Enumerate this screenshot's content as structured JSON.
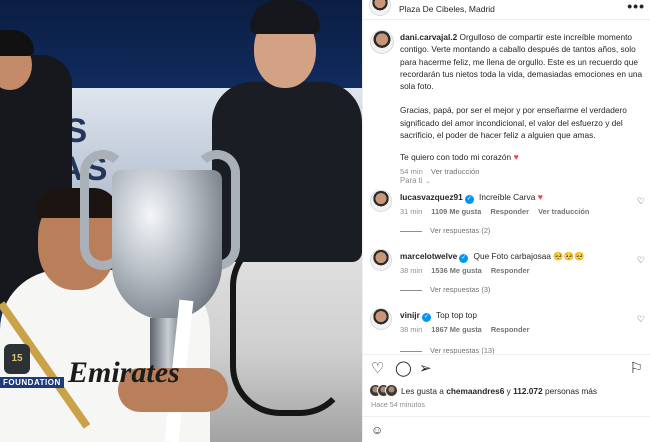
{
  "post_header": {
    "location": "Plaza De Cibeles, Madrid",
    "more_icon": "more-horizontal-icon"
  },
  "photo": {
    "bus_text": "AS\nTAS",
    "sponsor_text": "Emirates",
    "badge_text": "15",
    "foundation_text": "FOUNDATION"
  },
  "caption": {
    "username": "dani.carvajal.2",
    "paragraph_1": "Orgulloso de compartir este increíble momento contigo. Verte montando a caballo después de tantos años, solo para hacerme feliz, me llena de orgullo. Este es un recuerdo que recordarán tus nietos toda la vida, demasiadas emociones en una sola foto.",
    "paragraph_2": "Gracias, papá, por ser el mejor y por enseñarme el verdadero significado del amor incondicional, el valor del esfuerzo y del sacrificio, el poder de hacer feliz a alguien que amas.",
    "paragraph_3": "Te quiero con todo mi corazón",
    "heart_emoji": "♥",
    "time": "54 min",
    "translate": "Ver traducción"
  },
  "see_more": {
    "label": "Para ti",
    "chevron": "⌄"
  },
  "comments": [
    {
      "username": "lucasvazquez91",
      "text": "Increíble Carva ",
      "emoji": "♥",
      "time": "31 min",
      "likes": "1109 Me gusta",
      "reply": "Responder",
      "translate": "Ver traducción",
      "replies": "Ver respuestas (2)"
    },
    {
      "username": "marcelotwelve",
      "text": "Que Foto carbajosaa ",
      "emoji": "🥺🥺🥺",
      "time": "38 min",
      "likes": "1536 Me gusta",
      "reply": "Responder",
      "translate": "",
      "replies": "Ver respuestas (3)"
    },
    {
      "username": "vinijr",
      "text": "Top top top",
      "emoji": "",
      "time": "38 min",
      "likes": "1867 Me gusta",
      "reply": "Responder",
      "translate": "",
      "replies": "Ver respuestas (13)"
    }
  ],
  "actions": {
    "like_icon": "heart-outline-icon",
    "comment_icon": "comment-icon",
    "share_icon": "send-icon",
    "save_icon": "bookmark-icon"
  },
  "likes": {
    "prefix": "Les gusta a ",
    "user": "chemaandres6",
    "middle": " y ",
    "count": "112.072",
    "suffix": " personas más"
  },
  "post_time": "Hace 54 minutos",
  "colors": {
    "verified": "#0095f6",
    "heart": "#ed4956",
    "muted": "#8e8e8e"
  }
}
